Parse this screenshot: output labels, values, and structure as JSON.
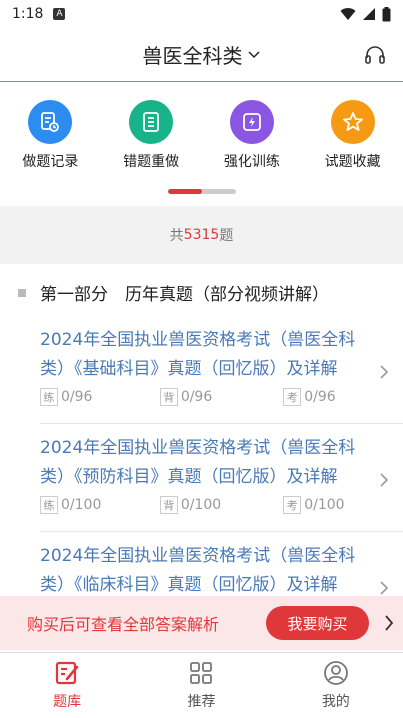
{
  "status": {
    "time": "1:18",
    "badge": "A"
  },
  "header": {
    "title": "兽医全科类"
  },
  "quick": [
    {
      "label": "做题记录",
      "color": "#2d8cf0",
      "icon": "record-icon"
    },
    {
      "label": "错题重做",
      "color": "#19b38a",
      "icon": "notebook-icon"
    },
    {
      "label": "强化训练",
      "color": "#8a56e2",
      "icon": "lightning-icon"
    },
    {
      "label": "试题收藏",
      "color": "#f79a13",
      "icon": "star-icon"
    }
  ],
  "count": {
    "prefix": "共",
    "num": "5315",
    "suffix": "题"
  },
  "section": {
    "title": "第一部分　历年真题（部分视频讲解）"
  },
  "items": [
    {
      "title": "2024年全国执业兽医资格考试（兽医全科类）《基础科目》真题（回忆版）及详解",
      "practice_tag": "练",
      "practice": "0/96",
      "recite_tag": "背",
      "recite": "0/96",
      "exam_tag": "考",
      "exam": "0/96"
    },
    {
      "title": "2024年全国执业兽医资格考试（兽医全科类）《预防科目》真题（回忆版）及详解",
      "practice_tag": "练",
      "practice": "0/100",
      "recite_tag": "背",
      "recite": "0/100",
      "exam_tag": "考",
      "exam": "0/100"
    },
    {
      "title": "2024年全国执业兽医资格考试（兽医全科类）《临床科目》真题（回忆版）及详解"
    }
  ],
  "buy": {
    "text": "购买后可查看全部答案解析",
    "button": "我要购买"
  },
  "tabs": [
    {
      "label": "题库"
    },
    {
      "label": "推荐"
    },
    {
      "label": "我的"
    }
  ],
  "colors": {
    "accent": "#e0373b",
    "link": "#4a79b6"
  }
}
